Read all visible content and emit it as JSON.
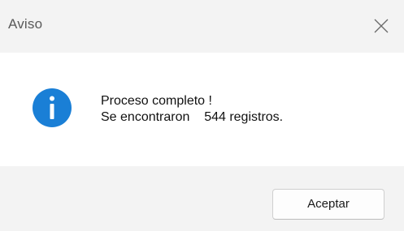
{
  "window": {
    "title": "Aviso",
    "close_icon": "close-icon"
  },
  "content": {
    "icon": "info-icon",
    "icon_color": "#1a7fd6",
    "line1": "Proceso completo !",
    "line2": "Se encontraron    544 registros."
  },
  "footer": {
    "ok_label": "Aceptar"
  }
}
